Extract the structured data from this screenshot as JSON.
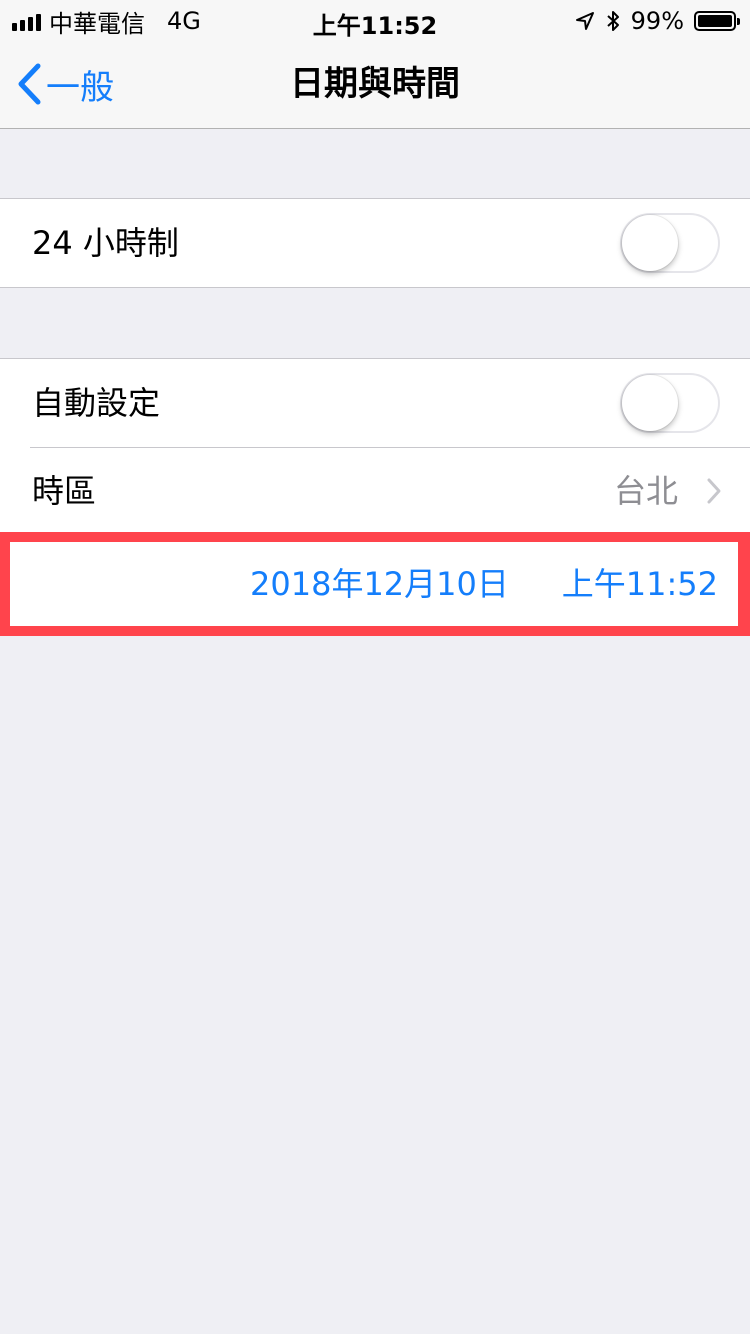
{
  "status_bar": {
    "carrier": "中華電信",
    "network": "4G",
    "time": "上午11:52",
    "battery_percent": "99%",
    "battery_level": 0.99,
    "icons": [
      "signal-icon",
      "location-icon",
      "bluetooth-icon",
      "battery-icon"
    ]
  },
  "nav": {
    "back_label": "一般",
    "title": "日期與時間",
    "back_icon": "chevron-left-icon"
  },
  "settings": {
    "hour24": {
      "label": "24 小時制",
      "on": false
    },
    "auto_set": {
      "label": "自動設定",
      "on": false
    },
    "timezone": {
      "label": "時區",
      "value": "台北",
      "icon": "chevron-right-icon"
    }
  },
  "datetime": {
    "date": "2018年12月10日",
    "time": "上午11:52"
  },
  "colors": {
    "accent": "#147efb",
    "background": "#efeff4",
    "highlight": "#ff444c",
    "secondary_text": "#8e8e93"
  }
}
